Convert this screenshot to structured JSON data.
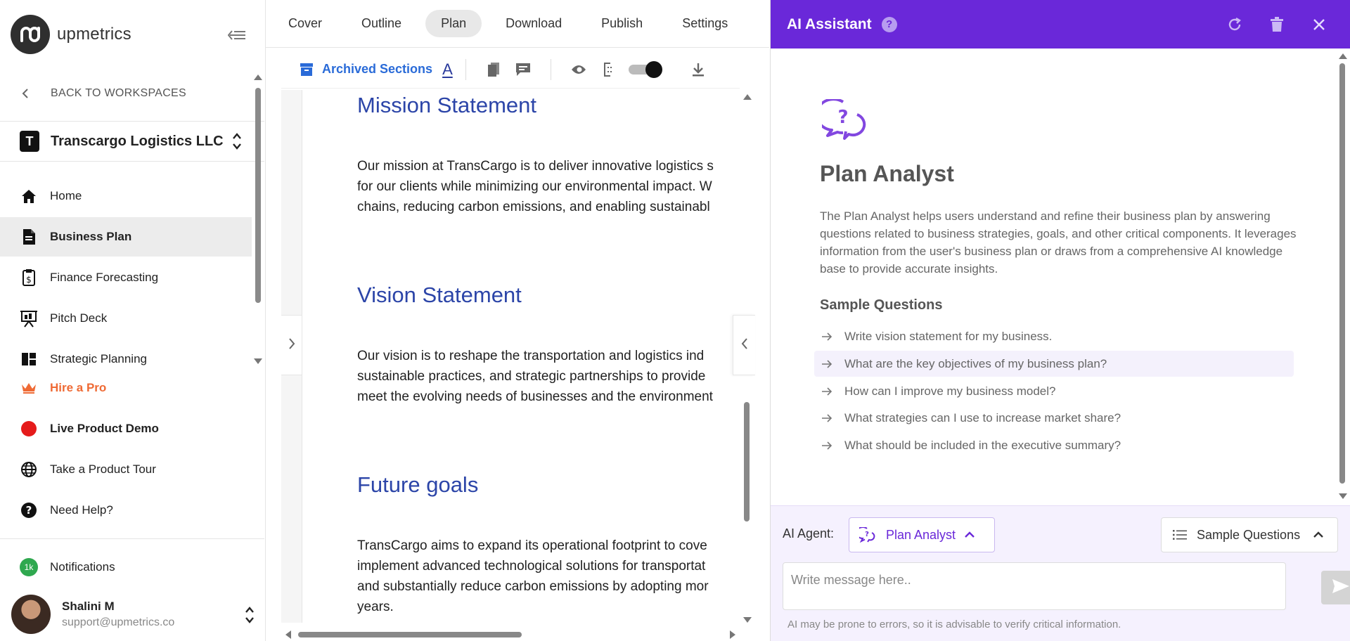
{
  "sidebar": {
    "brand": "upmetrics",
    "back_label": "BACK TO WORKSPACES",
    "workspace": {
      "initial": "T",
      "name": "Transcargo Logistics LLC"
    },
    "items": [
      {
        "label": "Home",
        "icon": "home-icon"
      },
      {
        "label": "Business Plan",
        "icon": "document-icon",
        "active": true
      },
      {
        "label": "Finance Forecasting",
        "icon": "finance-clipboard-icon"
      },
      {
        "label": "Pitch Deck",
        "icon": "presentation-icon"
      },
      {
        "label": "Strategic Planning",
        "icon": "dashboard-grid-icon"
      }
    ],
    "hire_label": "Hire a Pro",
    "demo_label": "Live Product Demo",
    "tour_label": "Take a Product Tour",
    "help_label": "Need Help?",
    "notifications": {
      "label": "Notifications",
      "badge": "1k"
    },
    "user": {
      "name": "Shalini M",
      "email": "support@upmetrics.co"
    },
    "colors": {
      "hire": "#ef6a34",
      "demo_dot": "#e51b1b",
      "notif_badge": "#2fa84f"
    }
  },
  "center": {
    "tabs": [
      "Cover",
      "Outline",
      "Plan",
      "Download",
      "Publish",
      "Settings"
    ],
    "active_tab": "Plan",
    "toolbar": {
      "archived_label": "Archived Sections",
      "font_label": "A"
    },
    "document": {
      "sections": [
        {
          "heading": "Mission Statement",
          "lines": [
            "Our mission at TransCargo is to deliver innovative logistics s",
            "for our clients while minimizing our environmental impact. W",
            "chains, reducing carbon emissions, and enabling sustainabl"
          ]
        },
        {
          "heading": "Vision Statement",
          "lines": [
            "Our vision is to reshape the transportation and logistics ind",
            "sustainable practices, and strategic partnerships to provide",
            "meet the evolving needs of businesses and the environment"
          ]
        },
        {
          "heading": "Future goals",
          "lines": [
            "TransCargo aims to expand its operational footprint to cove",
            "implement advanced technological solutions for transportat",
            "and substantially reduce carbon emissions by adopting mor",
            "years."
          ]
        }
      ]
    }
  },
  "ai": {
    "title": "AI Assistant",
    "help_glyph": "?",
    "agent": {
      "name": "Plan Analyst",
      "description": "The Plan Analyst helps users understand and refine their business plan by answering questions related to business strategies, goals, and other critical components. It leverages information from the user's business plan or draws from a comprehensive AI knowledge base to provide accurate insights."
    },
    "sample_title": "Sample Questions",
    "questions": [
      "Write vision statement for my business.",
      "What are the key objectives of my business plan?",
      "How can I improve my business model?",
      "What strategies can I use to increase market share?",
      "What should be included in the executive summary?"
    ],
    "footer": {
      "agent_label": "AI Agent:",
      "agent_select": "Plan Analyst",
      "questions_select": "Sample Questions",
      "placeholder": "Write message here..",
      "disclaimer": "AI may be prone to errors, so it is advisable to verify critical information."
    },
    "colors": {
      "header": "#6a28d9",
      "footer_bg": "#f5f1fe"
    }
  }
}
